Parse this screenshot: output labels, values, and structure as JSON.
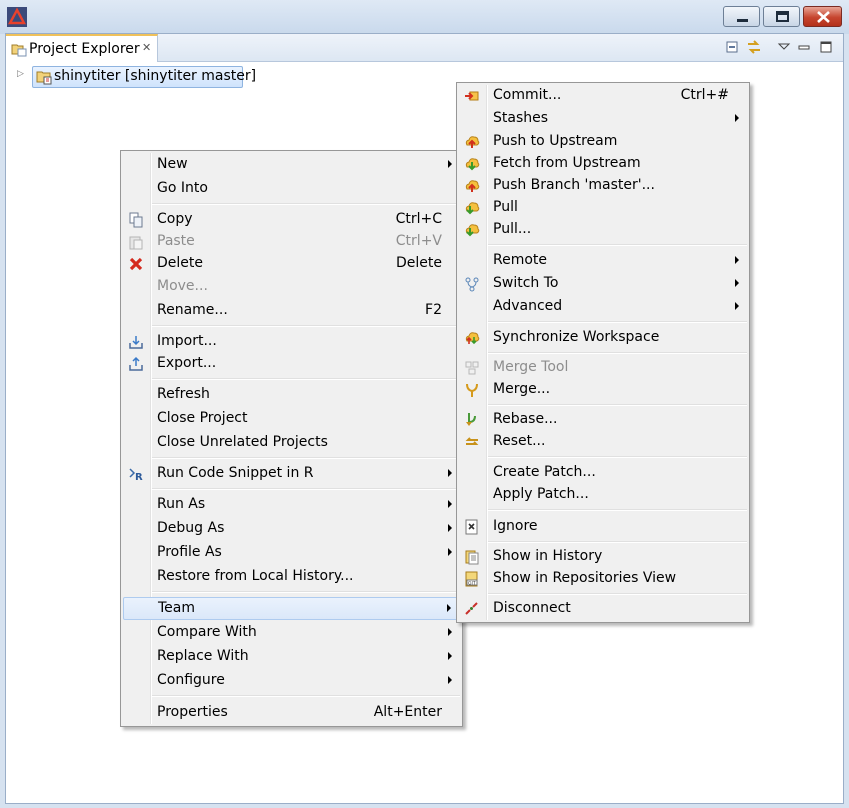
{
  "window": {
    "buttons": {
      "minimize": "minimize",
      "maximize": "maximize",
      "close": "close"
    }
  },
  "view": {
    "tab_label": "Project Explorer",
    "tab_close": "✕",
    "tree_item": "shinytiter [shinytiter master]"
  },
  "context_menu": {
    "new": "New",
    "go_into": "Go Into",
    "copy": "Copy",
    "copy_sc": "Ctrl+C",
    "paste": "Paste",
    "paste_sc": "Ctrl+V",
    "delete": "Delete",
    "delete_sc": "Delete",
    "move": "Move...",
    "rename": "Rename...",
    "rename_sc": "F2",
    "import": "Import...",
    "export": "Export...",
    "refresh": "Refresh",
    "close_project": "Close Project",
    "close_unrelated": "Close Unrelated Projects",
    "run_snippet": "Run Code Snippet in R",
    "run_as": "Run As",
    "debug_as": "Debug As",
    "profile_as": "Profile As",
    "restore": "Restore from Local History...",
    "team": "Team",
    "compare_with": "Compare With",
    "replace_with": "Replace With",
    "configure": "Configure",
    "properties": "Properties",
    "properties_sc": "Alt+Enter"
  },
  "team_menu": {
    "commit": "Commit...",
    "commit_sc": "Ctrl+#",
    "stashes": "Stashes",
    "push_upstream": "Push to Upstream",
    "fetch_upstream": "Fetch from Upstream",
    "push_branch": "Push Branch 'master'...",
    "pull": "Pull",
    "pull_dots": "Pull...",
    "remote": "Remote",
    "switch_to": "Switch To",
    "advanced": "Advanced",
    "synchronize": "Synchronize Workspace",
    "merge_tool": "Merge Tool",
    "merge": "Merge...",
    "rebase": "Rebase...",
    "reset": "Reset...",
    "create_patch": "Create Patch...",
    "apply_patch": "Apply Patch...",
    "ignore": "Ignore",
    "show_history": "Show in History",
    "show_repos": "Show in Repositories View",
    "disconnect": "Disconnect"
  },
  "colors": {
    "menu_bg": "#f0f0f0",
    "highlight": "#dbe8f9",
    "disabled_text": "#8d8d8d",
    "close_button": "#c6452f"
  }
}
